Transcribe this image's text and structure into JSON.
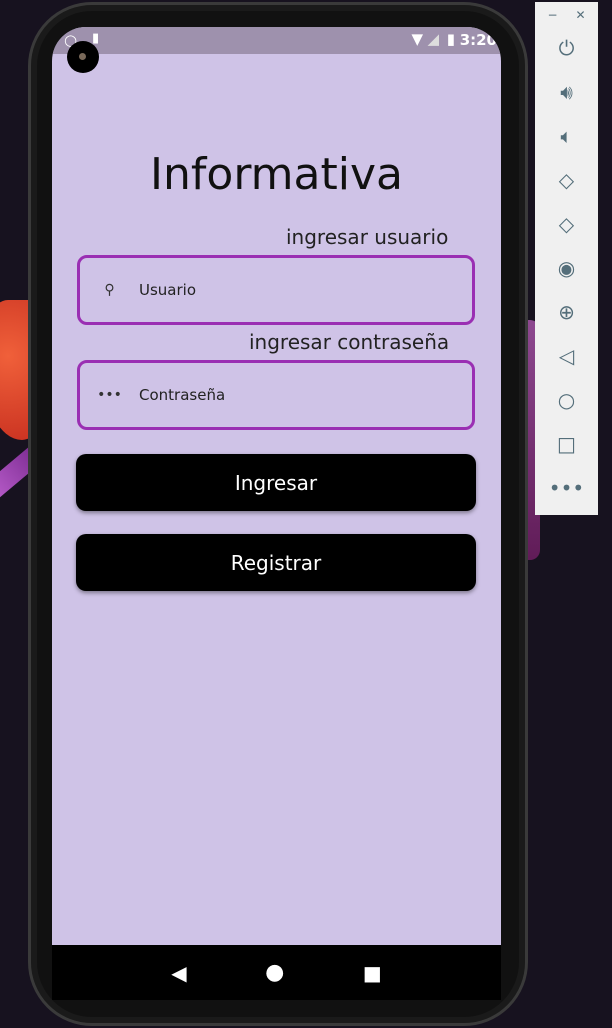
{
  "status_bar": {
    "time": "3:20",
    "icons": [
      "circle-icon",
      "sd-card-icon",
      "wifi-icon",
      "signal-icon",
      "battery-icon"
    ]
  },
  "app": {
    "title": "Informativa",
    "username_label": "ingresar usuario",
    "username_placeholder": "Usuario",
    "password_label": "ingresar contraseña",
    "password_placeholder": "Contraseña",
    "login_button": "Ingresar",
    "register_button": "Registrar",
    "accent_color": "#9a2fb3",
    "background_color": "#cfc3e7"
  },
  "nav_bar": {
    "icons": [
      "back-icon",
      "home-icon",
      "recents-icon"
    ]
  },
  "emulator_toolbar": {
    "icons": [
      "minimize-icon",
      "close-icon",
      "power-icon",
      "volume-up-icon",
      "volume-down-icon",
      "rotate-left-icon",
      "rotate-right-icon",
      "camera-icon",
      "zoom-icon",
      "back-icon",
      "home-icon",
      "overview-icon",
      "more-icon"
    ]
  }
}
